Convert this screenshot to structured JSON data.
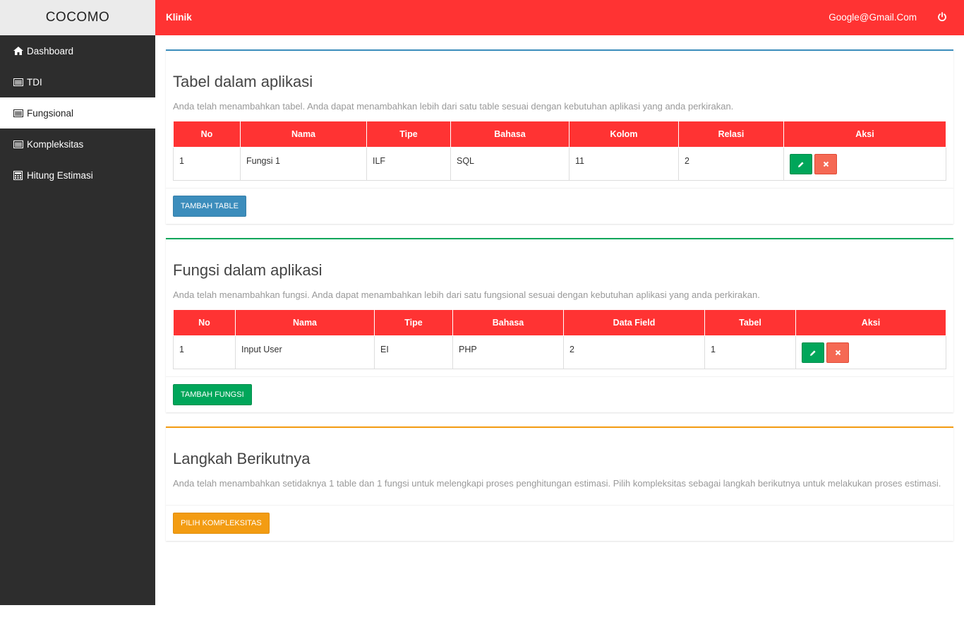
{
  "sidebar": {
    "brand": "COCOMO",
    "items": [
      {
        "label": "Dashboard",
        "icon": "home-icon"
      },
      {
        "label": "TDI",
        "icon": "list-icon"
      },
      {
        "label": "Fungsional",
        "icon": "list-icon"
      },
      {
        "label": "Kompleksitas",
        "icon": "list-icon"
      },
      {
        "label": "Hitung Estimasi",
        "icon": "calculator-icon"
      }
    ]
  },
  "topbar": {
    "title": "Klinik",
    "email": "Google@Gmail.Com",
    "logout_icon": "power-icon",
    "color": "#ff3333"
  },
  "tables_section": {
    "title": "Tabel dalam aplikasi",
    "description": "Anda telah menambahkan tabel. Anda dapat menambahkan lebih dari satu table sesuai dengan kebutuhan aplikasi yang anda perkirakan.",
    "headers": [
      "No",
      "Nama",
      "Tipe",
      "Bahasa",
      "Kolom",
      "Relasi",
      "Aksi"
    ],
    "rows": [
      [
        "1",
        "Fungsi 1",
        "ILF",
        "SQL",
        "11",
        "2"
      ]
    ],
    "button": "TAMBAH TABLE"
  },
  "functions_section": {
    "title": "Fungsi dalam aplikasi",
    "description": "Anda telah menambahkan fungsi. Anda dapat menambahkan lebih dari satu fungsional sesuai dengan kebutuhan aplikasi yang anda perkirakan.",
    "headers": [
      "No",
      "Nama",
      "Tipe",
      "Bahasa",
      "Data Field",
      "Tabel",
      "Aksi"
    ],
    "rows": [
      [
        "1",
        "Input User",
        "EI",
        "PHP",
        "2",
        "1"
      ]
    ],
    "button": "TAMBAH FUNGSI"
  },
  "next_section": {
    "title": "Langkah Berikutnya",
    "description": "Anda telah menambahkan setidaknya 1 table dan 1 fungsi untuk melengkapi proses penghitungan estimasi. Pilih kompleksitas sebagai langkah berikutnya untuk melakukan proses estimasi.",
    "button": "PILIH KOMPLEKSITAS"
  }
}
